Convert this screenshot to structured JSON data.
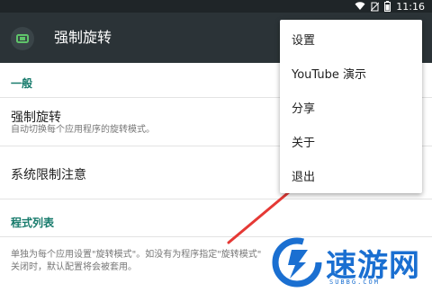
{
  "status_bar": {
    "time": "11:16",
    "icons": [
      "wifi-icon",
      "no-sim-icon",
      "battery-icon"
    ]
  },
  "app_bar": {
    "title": "强制旋转",
    "icon": "rotate-app-icon"
  },
  "sections": {
    "general_header": "一般",
    "force_rotation_title": "强制旋转",
    "force_rotation_sub": "自动切换每个应用程序的旋转模式。",
    "system_limit_title": "系统限制注意",
    "app_list_header": "程式列表",
    "app_list_desc_line1": "单独为每个应用设置\"旋转模式\"。如没有为程序指定\"旋转模式\"",
    "app_list_desc_line2": "关闭时，默认配置将会被套用。"
  },
  "menu": {
    "items": [
      "设置",
      "YouTube 演示",
      "分享",
      "关于",
      "退出"
    ]
  },
  "watermark": {
    "brand": "速游网",
    "url": "SUBBG.COM"
  },
  "colors": {
    "app_bar": "#2b3337",
    "status_bar": "#1f2528",
    "section_header": "#167a6b",
    "arrow": "#e53935",
    "watermark": "#1a6fd1"
  }
}
